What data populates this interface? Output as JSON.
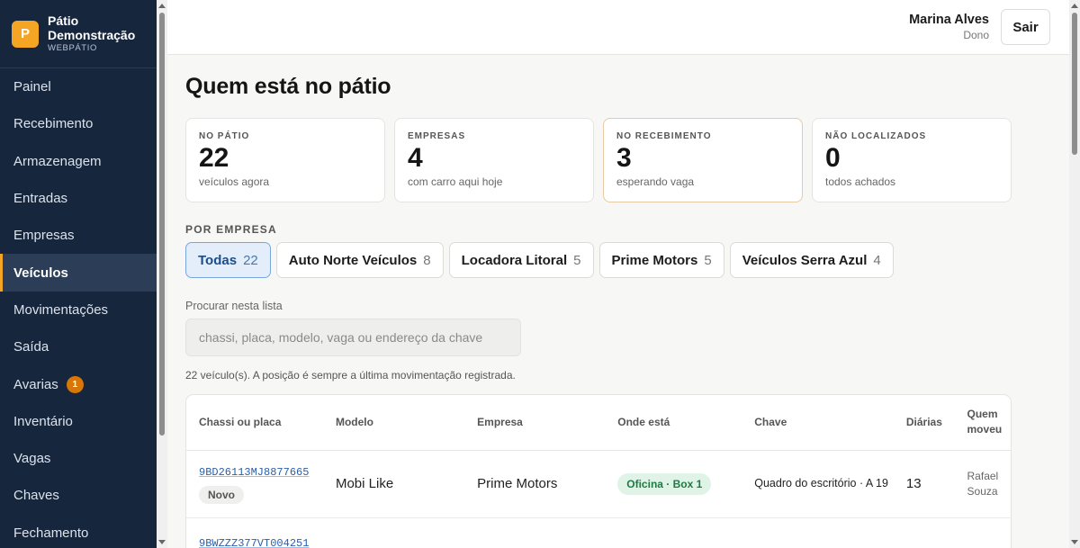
{
  "brand": {
    "logo_letter": "P",
    "name": "Pátio Demonstração",
    "sub": "WEBPÁTIO"
  },
  "sidebar": {
    "items": [
      {
        "label": "Painel"
      },
      {
        "label": "Recebimento"
      },
      {
        "label": "Armazenagem"
      },
      {
        "label": "Entradas"
      },
      {
        "label": "Empresas"
      },
      {
        "label": "Veículos",
        "active": true
      },
      {
        "label": "Movimentações"
      },
      {
        "label": "Saída"
      },
      {
        "label": "Avarias",
        "badge": "1"
      },
      {
        "label": "Inventário"
      },
      {
        "label": "Vagas"
      },
      {
        "label": "Chaves"
      },
      {
        "label": "Fechamento"
      }
    ]
  },
  "header": {
    "user_name": "Marina Alves",
    "user_role": "Dono",
    "logout_label": "Sair"
  },
  "page": {
    "title": "Quem está no pátio"
  },
  "stats": [
    {
      "label": "NO PÁTIO",
      "value": "22",
      "desc": "veículos agora"
    },
    {
      "label": "EMPRESAS",
      "value": "4",
      "desc": "com carro aqui hoje"
    },
    {
      "label": "NO RECEBIMENTO",
      "value": "3",
      "desc": "esperando vaga"
    },
    {
      "label": "NÃO LOCALIZADOS",
      "value": "0",
      "desc": "todos achados"
    }
  ],
  "filters": {
    "section_label": "POR EMPRESA",
    "chips": [
      {
        "label": "Todas",
        "count": "22",
        "active": true
      },
      {
        "label": "Auto Norte Veículos",
        "count": "8"
      },
      {
        "label": "Locadora Litoral",
        "count": "5"
      },
      {
        "label": "Prime Motors",
        "count": "5"
      },
      {
        "label": "Veículos Serra Azul",
        "count": "4"
      }
    ]
  },
  "search": {
    "label": "Procurar nesta lista",
    "placeholder": "chassi, placa, modelo, vaga ou endereço da chave"
  },
  "result_info": "22 veículo(s). A posição é sempre a última movimentação registrada.",
  "table": {
    "columns": [
      "Chassi ou placa",
      "Modelo",
      "Empresa",
      "Onde está",
      "Chave",
      "Diárias",
      "Quem moveu"
    ],
    "rows": [
      {
        "chassi": "9BD26113MJ8877665",
        "tag": "Novo",
        "modelo": "Mobi Like",
        "empresa": "Prime Motors",
        "onde": "Oficina · Box 1",
        "chave": "Quadro do escritório · A 19",
        "diarias": "13",
        "quem": "Rafael Souza"
      },
      {
        "chassi": "9BWZZZ377VT004251"
      }
    ]
  }
}
